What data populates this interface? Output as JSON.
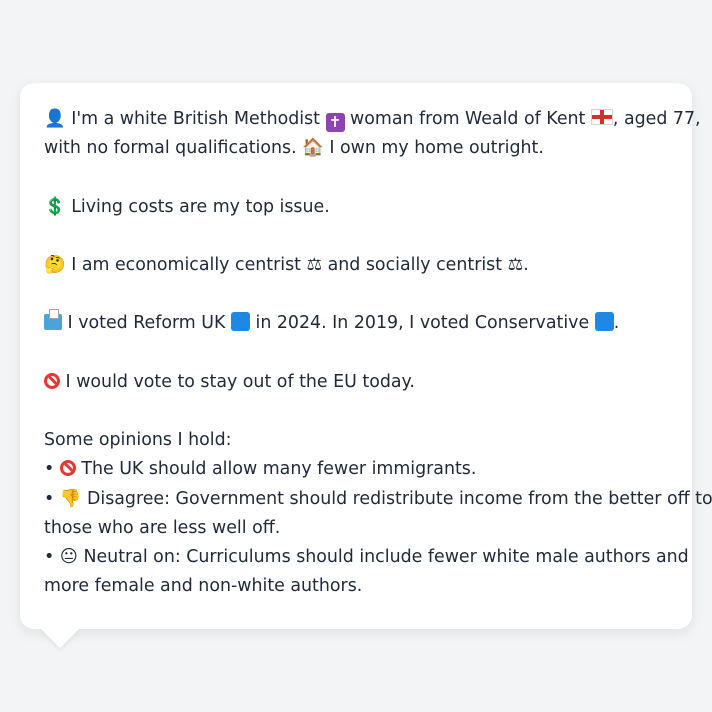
{
  "profile": {
    "line1_a": "I'm a white British Methodist",
    "line1_b": "woman from Weald of Kent",
    "line1_c": ", aged 77,",
    "line2_a": "with no formal qualifications.",
    "line2_b": "I own my home outright.",
    "line3": "Living costs are my top issue.",
    "line4_a": "I am economically centrist",
    "line4_b": "and socially centrist",
    "line4_c": ".",
    "line5_a": "I voted Reform UK",
    "line5_b": "in 2024. In 2019, I voted Conservative",
    "line5_c": ".",
    "line6": "I would vote to stay out of the EU today.",
    "opinions_heading": "Some opinions I hold:",
    "opinion1": "The UK should allow many fewer immigrants.",
    "opinion2_a": "Disagree: Government should redistribute income from the better off to",
    "opinion2_b": "those who are less well off.",
    "opinion3_a": "Neutral on: Curriculums should include fewer white male authors and",
    "opinion3_b": "more female and non-white authors."
  },
  "glyphs": {
    "person": "👤",
    "cross": "✝",
    "house": "🏠",
    "dollar": "💲",
    "thinking": "🤔",
    "scales": "⚖",
    "thumbs_down": "👎",
    "neutral": "😐",
    "bullet": "•"
  },
  "colors": {
    "reform_square": "#1e88e5",
    "conservative_square": "#1e88e5"
  }
}
